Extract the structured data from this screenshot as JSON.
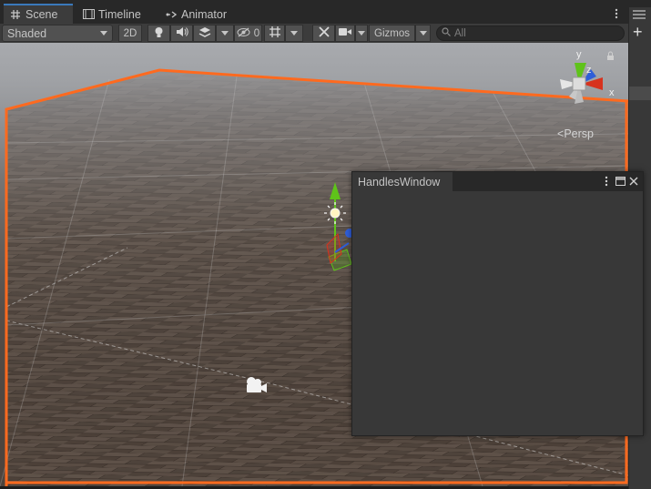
{
  "tabs": [
    {
      "label": "Scene",
      "icon": "hash-grid-icon",
      "active": true
    },
    {
      "label": "Timeline",
      "icon": "film-icon",
      "active": false
    },
    {
      "label": "Animator",
      "icon": "animator-icon",
      "active": false
    }
  ],
  "toolbar": {
    "draw_mode": "Shaded",
    "toggle_2d": "2D",
    "hidden_count": "0",
    "gizmos_label": "Gizmos",
    "search_placeholder": "All"
  },
  "scene": {
    "persp_label": "Persp",
    "axis_labels": {
      "x": "x",
      "y": "y",
      "z": "z"
    },
    "selection_outline_color": "#ff6a1f",
    "axis_colors": {
      "x": "#d7321e",
      "y": "#5fc31a",
      "z": "#2f5ed8"
    }
  },
  "handles_window": {
    "title": "HandlesWindow"
  },
  "right_panel": {
    "add_label": "+"
  }
}
